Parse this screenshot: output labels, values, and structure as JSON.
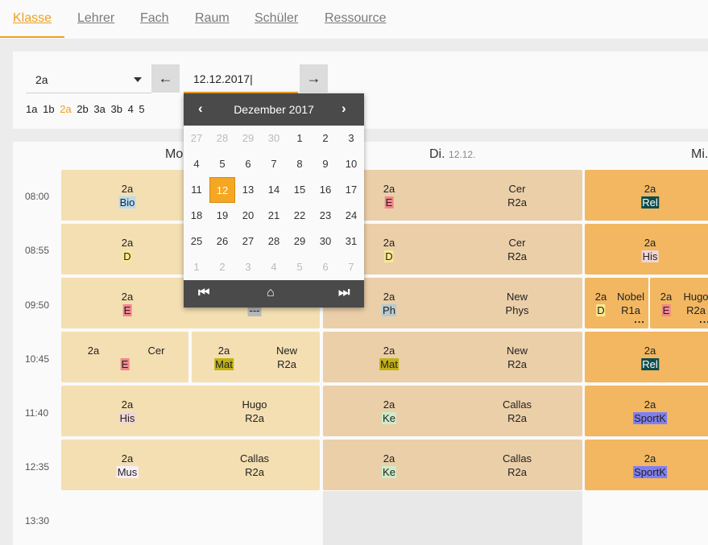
{
  "tabs": [
    "Klasse",
    "Lehrer",
    "Fach",
    "Raum",
    "Schüler",
    "Ressource"
  ],
  "filter": {
    "class_value": "2a",
    "date_value": "12.12.2017|",
    "prev_icon": "arrow-left-icon",
    "next_icon": "arrow-right-icon",
    "quick_classes": [
      "1a",
      "1b",
      "2a",
      "2b",
      "3a",
      "3b",
      "4",
      "5"
    ],
    "quick_active": "2a"
  },
  "days": [
    {
      "name": "Mo",
      "date": ""
    },
    {
      "name": "Di.",
      "date": "12.12."
    },
    {
      "name": "Mi.",
      "date": ""
    }
  ],
  "times": [
    "08:00",
    "08:55",
    "09:50",
    "10:45",
    "11:40",
    "12:35",
    "13:30"
  ],
  "colors": {
    "accent": "#f0a020",
    "monday_cell": "#f4dfb2",
    "tuesday_cell": "#ebcfa9",
    "wednesday_cell": "#f2b760"
  },
  "lessons": {
    "mon": [
      {
        "cls": "2a",
        "subject": "Bio",
        "subject_color": "#b8dcf2",
        "teacher": "",
        "room": ""
      },
      {
        "cls": "2a",
        "subject": "D",
        "subject_color": "#fbe98f",
        "teacher": "",
        "room": ""
      },
      {
        "cls": "2a",
        "subject": "E",
        "subject_color": "#f2868c",
        "teacher": "",
        "room": "",
        "extra": "---"
      },
      {
        "cls": "2a",
        "subject": "E",
        "subject_color": "#f2868c",
        "teacher": "Cer",
        "room": ""
      },
      {
        "cls": "2a",
        "subject": "Mat",
        "subject_color": "#c2b217",
        "teacher": "New",
        "room": "R2a"
      },
      {
        "cls": "2a",
        "subject": "His",
        "subject_color": "#f1d5d5",
        "teacher": "Hugo",
        "room": "R2a"
      },
      {
        "cls": "2a",
        "subject": "Mus",
        "subject_color": "#f8eef8",
        "teacher": "Callas",
        "room": "R2a"
      }
    ],
    "tue": [
      {
        "cls": "2a",
        "subject": "E",
        "subject_color": "#f2868c",
        "teacher": "Cer",
        "room": "R2a"
      },
      {
        "cls": "2a",
        "subject": "D",
        "subject_color": "#fbe98f",
        "teacher": "Cer",
        "room": "R2a"
      },
      {
        "cls": "2a",
        "subject": "Ph",
        "subject_color": "#b5cbd1",
        "teacher": "New",
        "room": "Phys"
      },
      {
        "cls": "2a",
        "subject": "Mat",
        "subject_color": "#c2b217",
        "teacher": "New",
        "room": "R2a"
      },
      {
        "cls": "2a",
        "subject": "Ke",
        "subject_color": "#cdecc9",
        "teacher": "Callas",
        "room": "R2a"
      },
      {
        "cls": "2a",
        "subject": "Ke",
        "subject_color": "#cdecc9",
        "teacher": "Callas",
        "room": "R2a"
      }
    ],
    "wed": [
      {
        "cls": "2a",
        "subject": "Rel",
        "subject_color": "#0e4d4d",
        "subject_text": "#ffffff"
      },
      {
        "cls": "2a",
        "subject": "His",
        "subject_color": "#f1d5d5",
        "subject_text": "#222222"
      },
      {
        "cls": "2a",
        "subject": "D",
        "subject_color": "#fbe98f",
        "teacher": "Nobel",
        "room": "R1a"
      },
      {
        "cls": "2a",
        "subject": "E",
        "subject_color": "#f2868c",
        "teacher": "Hugo",
        "room": "R2a"
      },
      {
        "cls": "2a",
        "subject": "Rel",
        "subject_color": "#0e4d4d",
        "subject_text": "#ffffff"
      },
      {
        "cls": "2a",
        "subject": "SportK",
        "subject_color": "#7f7ff0",
        "subject_text": "#222222"
      },
      {
        "cls": "2a",
        "subject": "SportK",
        "subject_color": "#7f7ff0",
        "subject_text": "#222222"
      }
    ]
  },
  "more_marker": "...",
  "calendar": {
    "title": "Dezember 2017",
    "prev_icon": "chevron-left-icon",
    "next_icon": "chevron-right-icon",
    "rows": [
      [
        "27",
        "28",
        "29",
        "30",
        "1",
        "2",
        "3"
      ],
      [
        "4",
        "5",
        "6",
        "7",
        "8",
        "9",
        "10"
      ],
      [
        "11",
        "12",
        "13",
        "14",
        "15",
        "16",
        "17"
      ],
      [
        "18",
        "19",
        "20",
        "21",
        "22",
        "23",
        "24"
      ],
      [
        "25",
        "26",
        "27",
        "28",
        "29",
        "30",
        "31"
      ],
      [
        "1",
        "2",
        "3",
        "4",
        "5",
        "6",
        "7"
      ]
    ],
    "selected": "12",
    "footer_icons": [
      "skip-first-icon",
      "home-icon",
      "skip-last-icon"
    ]
  }
}
